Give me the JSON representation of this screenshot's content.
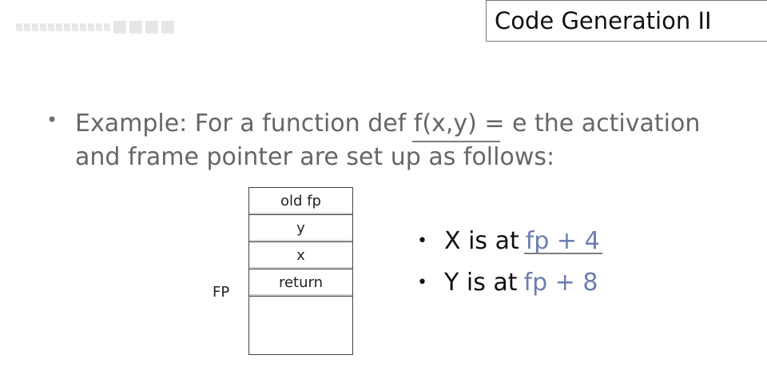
{
  "header": {
    "title": "Code Generation II"
  },
  "main": {
    "bullet": "•",
    "line1": "Example: For a function def f(x,y) = e the activation",
    "line2": "and frame pointer are set up as follows:"
  },
  "frame": {
    "cells": [
      "old fp",
      "y",
      "x",
      "return",
      ""
    ],
    "fp_label": "FP"
  },
  "side": {
    "bullet": "•",
    "items": [
      {
        "text": "X is at",
        "offset": "fp + 4"
      },
      {
        "text": "Y is at",
        "offset": "fp + 8"
      }
    ]
  },
  "colors": {
    "accent_text": "#6d7db2",
    "body_text": "#666666",
    "title_border": "#777777"
  }
}
